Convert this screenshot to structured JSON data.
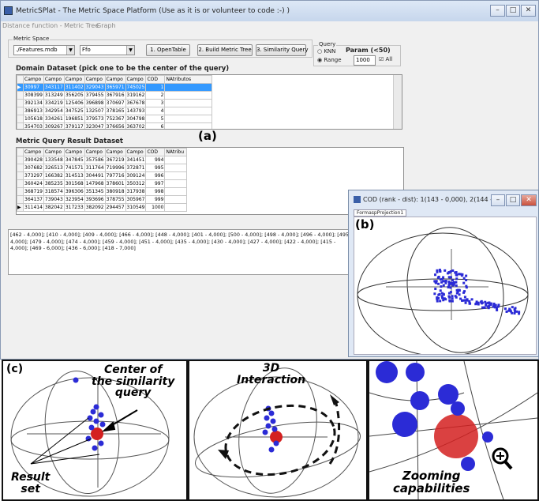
{
  "main_window": {
    "title": "MetricSPlat - The Metric Space Platform (Use as it is or volunteer to code :-) )",
    "menu": [
      "Distance function - Metric Tree",
      "Graph"
    ],
    "metric_space_label": "Metric Space",
    "file_combo": "./Features.mdb",
    "table_combo": "Ffo",
    "buttons": {
      "open_table": "1. OpenTable",
      "build_tree": "2. Build Metric Tree",
      "similarity_query": "3. Similarity Query"
    },
    "query": {
      "group_label": "Query",
      "knn_label": "KNN",
      "range_label": "Range",
      "param_label": "Param (<50)",
      "param_value": "1000",
      "all_label": "All",
      "selected_mode": "Range",
      "all_checked": true
    },
    "domain": {
      "title": "Domain Dataset (pick one to be the center of the query)",
      "columns": [
        "Campo",
        "Campo",
        "Campo",
        "Campo",
        "Campo",
        "Campo",
        "COD",
        "NAtributos"
      ],
      "rows": [
        [
          "30997",
          "343117",
          "311402",
          "329043",
          "365971",
          "745025",
          "1",
          ""
        ],
        [
          "308399",
          "313249",
          "356205",
          "379455",
          "367916",
          "319162",
          "2",
          ""
        ],
        [
          "392134",
          "334219",
          "125406",
          "396898",
          "370697",
          "367678",
          "3",
          ""
        ],
        [
          "386913",
          "342954",
          "347525",
          "132507",
          "378165",
          "143793",
          "4",
          ""
        ],
        [
          "105618",
          "334261",
          "196851",
          "379573",
          "752367",
          "304798",
          "5",
          ""
        ],
        [
          "354703",
          "309267",
          "379117",
          "323047",
          "376656",
          "363702",
          "6",
          ""
        ]
      ]
    },
    "result": {
      "title": "Metric Query Result Dataset",
      "columns": [
        "Campo",
        "Campo",
        "Campo",
        "Campo",
        "Campo",
        "Campo",
        "COD",
        "NAtribu"
      ],
      "rows": [
        [
          "390428",
          "133548",
          "347845",
          "357586",
          "367219",
          "341451",
          "994",
          ""
        ],
        [
          "307682",
          "326513",
          "741571",
          "311764",
          "719996",
          "372871",
          "995",
          ""
        ],
        [
          "373297",
          "166382",
          "314513",
          "304491",
          "797716",
          "309124",
          "996",
          ""
        ],
        [
          "360424",
          "385235",
          "301568",
          "147968",
          "378601",
          "350312",
          "997",
          ""
        ],
        [
          "368719",
          "318574",
          "396306",
          "351345",
          "380918",
          "317938",
          "998",
          ""
        ],
        [
          "364137",
          "739043",
          "323954",
          "393696",
          "378755",
          "305967",
          "999",
          ""
        ],
        [
          "311414",
          "382042",
          "317233",
          "382092",
          "294457",
          "310549",
          "1000",
          ""
        ]
      ]
    },
    "result_text": "[462 - 4,000]; [410 - 4,000]; [409 - 4,000]; [466 - 4,000]; [448 - 4,000]; [401 - 4,000]; [500 - 4,000]; [498 - 4,000]; [496 - 4,000]; [495 - 4,000]; [479 - 4,000]; [474 - 4,000]; [459 - 4,000]; [451 - 4,000]; [435 - 4,000]; [430 - 4,000]; [427 - 4,000]; [422 - 4,000]; [415 - 4,000]; [469 - 6,000]; [436 - 6,000]; [418 - 7,000]"
  },
  "plot_window": {
    "title": "COD (rank - dist): 1(143 - 0,000), 2(144 - ...",
    "tab": "FormaspProjection1"
  },
  "labels": {
    "a": "(a)",
    "b": "(b)",
    "c": "(c)"
  },
  "annotations": {
    "center_line1": "Center of",
    "center_line2": "the similarity",
    "center_line3": "query",
    "result_line1": "Result",
    "result_line2": "set",
    "interaction_line1": "3D",
    "interaction_line2": "Interaction",
    "zoom_line1": "Zooming",
    "zoom_line2": "capabilities"
  },
  "colors": {
    "point_blue": "#2b2bd6",
    "center_red": "#d42020",
    "selection": "#3399ff"
  },
  "icons": [
    "app-icon",
    "minimize-icon",
    "maximize-icon",
    "close-icon",
    "zoom-in-icon"
  ]
}
